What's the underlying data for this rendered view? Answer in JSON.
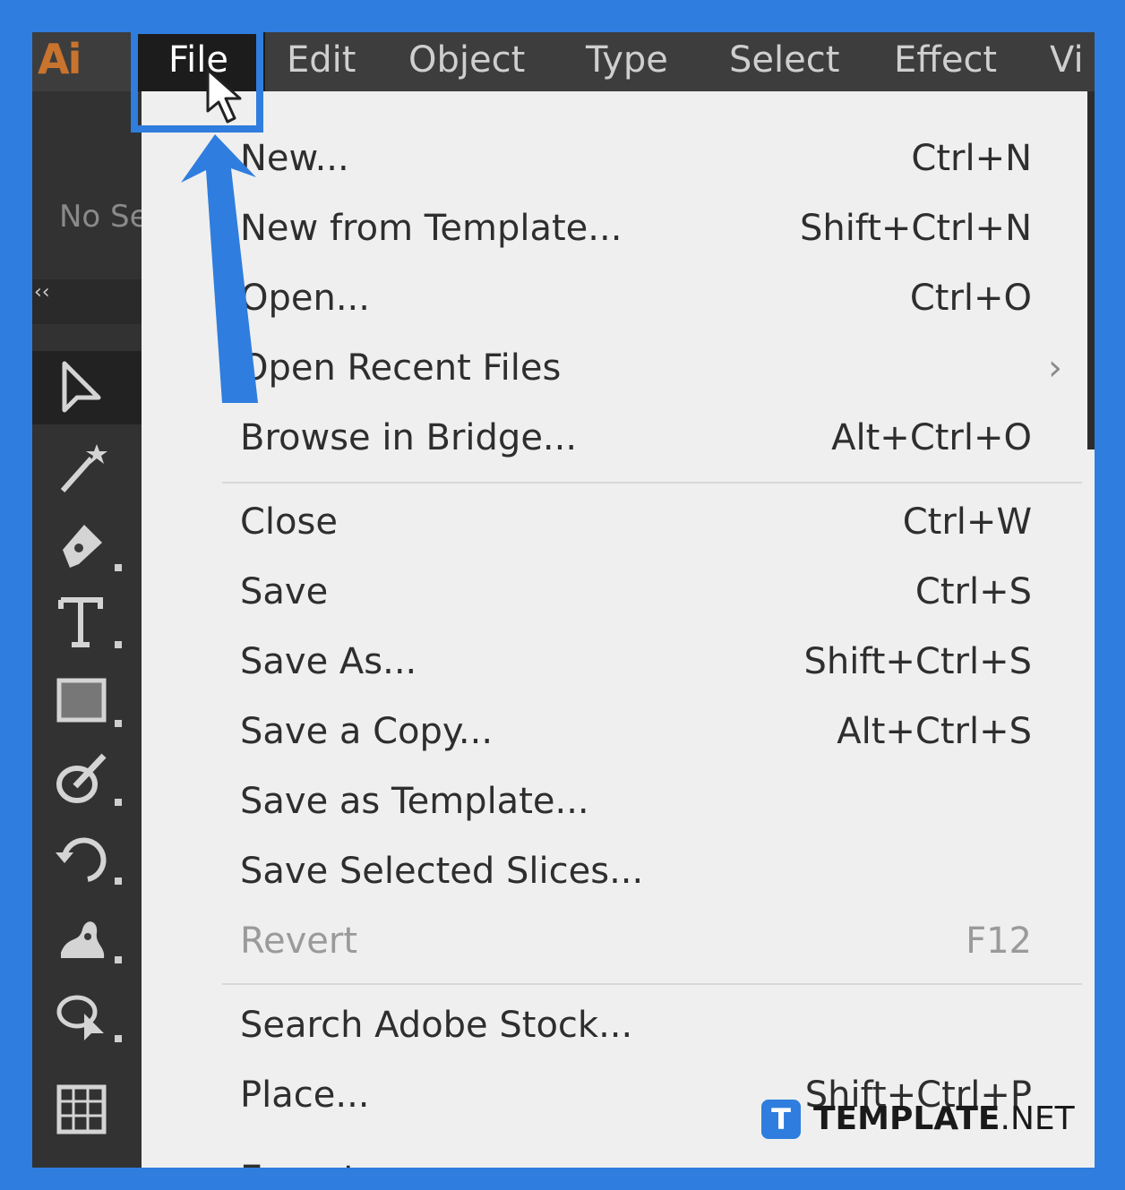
{
  "app": {
    "logo": "Ai"
  },
  "menubar": {
    "items": [
      {
        "label": "File"
      },
      {
        "label": "Edit"
      },
      {
        "label": "Object"
      },
      {
        "label": "Type"
      },
      {
        "label": "Select"
      },
      {
        "label": "Effect"
      },
      {
        "label": "Vi"
      }
    ]
  },
  "control_panel": {
    "selection_text": "No Se"
  },
  "toolbar": {
    "tools": [
      {
        "icon": "selection-arrow-icon"
      },
      {
        "icon": "magic-wand-icon"
      },
      {
        "icon": "pen-tool-icon"
      },
      {
        "icon": "type-tool-icon"
      },
      {
        "icon": "rectangle-tool-icon"
      },
      {
        "icon": "shaper-tool-icon"
      },
      {
        "icon": "rotate-tool-icon"
      },
      {
        "icon": "puppet-warp-icon"
      },
      {
        "icon": "shape-builder-icon"
      },
      {
        "icon": "mesh-tool-icon"
      }
    ]
  },
  "file_menu": {
    "items": [
      {
        "label": "New...",
        "shortcut": "Ctrl+N"
      },
      {
        "label": "New from Template...",
        "shortcut": "Shift+Ctrl+N"
      },
      {
        "label": "Open...",
        "shortcut": "Ctrl+O"
      },
      {
        "label": "Open Recent Files",
        "shortcut": "›"
      },
      {
        "label": "Browse in Bridge...",
        "shortcut": "Alt+Ctrl+O"
      },
      {
        "label": "Close",
        "shortcut": "Ctrl+W"
      },
      {
        "label": "Save",
        "shortcut": "Ctrl+S"
      },
      {
        "label": "Save As...",
        "shortcut": "Shift+Ctrl+S"
      },
      {
        "label": "Save a Copy...",
        "shortcut": "Alt+Ctrl+S"
      },
      {
        "label": "Save as Template...",
        "shortcut": ""
      },
      {
        "label": "Save Selected Slices...",
        "shortcut": ""
      },
      {
        "label": "Revert",
        "shortcut": "F12",
        "disabled": true
      },
      {
        "label": "Search Adobe Stock...",
        "shortcut": ""
      },
      {
        "label": "Place...",
        "shortcut": "Shift+Ctrl+P"
      },
      {
        "label": "Export",
        "shortcut": "›"
      }
    ]
  },
  "watermark": {
    "icon_letter": "T",
    "brand": "TEMPLATE",
    "suffix": ".NET"
  },
  "colors": {
    "annotation_blue": "#2f7dde",
    "logo_orange": "#c8732e",
    "menu_bg": "#efefef",
    "app_dark": "#3a3a3a"
  }
}
